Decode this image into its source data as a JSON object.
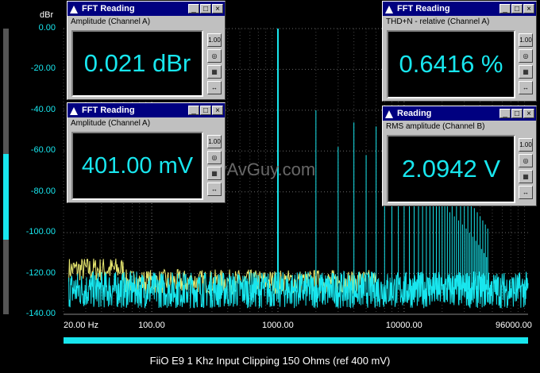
{
  "y_unit": "dBr",
  "caption": "FiiO E9 1 Khz Input Clipping 150 Ohms (ref 400 mV)",
  "watermark": "© 2011 NwAvGuy.com",
  "colors": {
    "accent": "#18e6ee",
    "yellow": "#e8e870",
    "title": "#000080"
  },
  "chart_data": {
    "type": "line",
    "title": "",
    "xlabel": "",
    "ylabel": "dBr",
    "x_scale": "log",
    "xlim": [
      20,
      96000
    ],
    "ylim": [
      -140,
      0
    ],
    "y_ticks": [
      "0.00",
      "-20.00",
      "-40.00",
      "-60.00",
      "-80.00",
      "-100.00",
      "-120.00",
      "-140.00"
    ],
    "x_ticks": [
      {
        "value": 20,
        "label": "20.00 Hz"
      },
      {
        "value": 100,
        "label": "100.00"
      },
      {
        "value": 1000,
        "label": "1000.00"
      },
      {
        "value": 10000,
        "label": "10000.00"
      },
      {
        "value": 96000,
        "label": "96000.00"
      }
    ],
    "grid": true,
    "series": [
      {
        "color": "#18e6ee",
        "fundamental": {
          "x": 1000,
          "y": 0
        },
        "harmonic_peaks_db": [
          -40,
          -58,
          -46,
          -62,
          -48,
          -66,
          -52,
          -70,
          -56,
          -74,
          -58,
          -78,
          -62,
          -80,
          -64,
          -82,
          -66,
          -85,
          -70,
          -87,
          -72,
          -90,
          -75,
          -92,
          -78,
          -94,
          -80,
          -96,
          -82,
          -98,
          -84,
          -100,
          -86,
          -102,
          -88,
          -104,
          -90,
          -106,
          -92,
          -108,
          -94,
          -110,
          -96,
          -112,
          -98
        ],
        "noise_floor_db": -128
      },
      {
        "color": "#e8e870",
        "noise_floor_db": -124
      }
    ]
  },
  "windows": [
    {
      "id": "w1",
      "title": "FFT Reading",
      "subtitle": "Amplitude (Channel A)",
      "value": "0.021 dBr"
    },
    {
      "id": "w2",
      "title": "FFT Reading",
      "subtitle": "Amplitude (Channel A)",
      "value": "401.00 mV"
    },
    {
      "id": "w3",
      "title": "FFT Reading",
      "subtitle": "THD+N - relative (Channel A)",
      "value": "0.6416 %"
    },
    {
      "id": "w4",
      "title": "Reading",
      "subtitle": "RMS amplitude (Channel B)",
      "value": "2.0942 V"
    }
  ],
  "tool_icons": [
    "scale-1-00-icon",
    "target-icon",
    "chart-edit-icon",
    "move-arrows-icon"
  ],
  "tool_labels": [
    "1.00",
    "◎",
    "▦",
    "↔"
  ],
  "window_buttons": {
    "minimize": "_",
    "maximize": "□",
    "close": "×"
  }
}
